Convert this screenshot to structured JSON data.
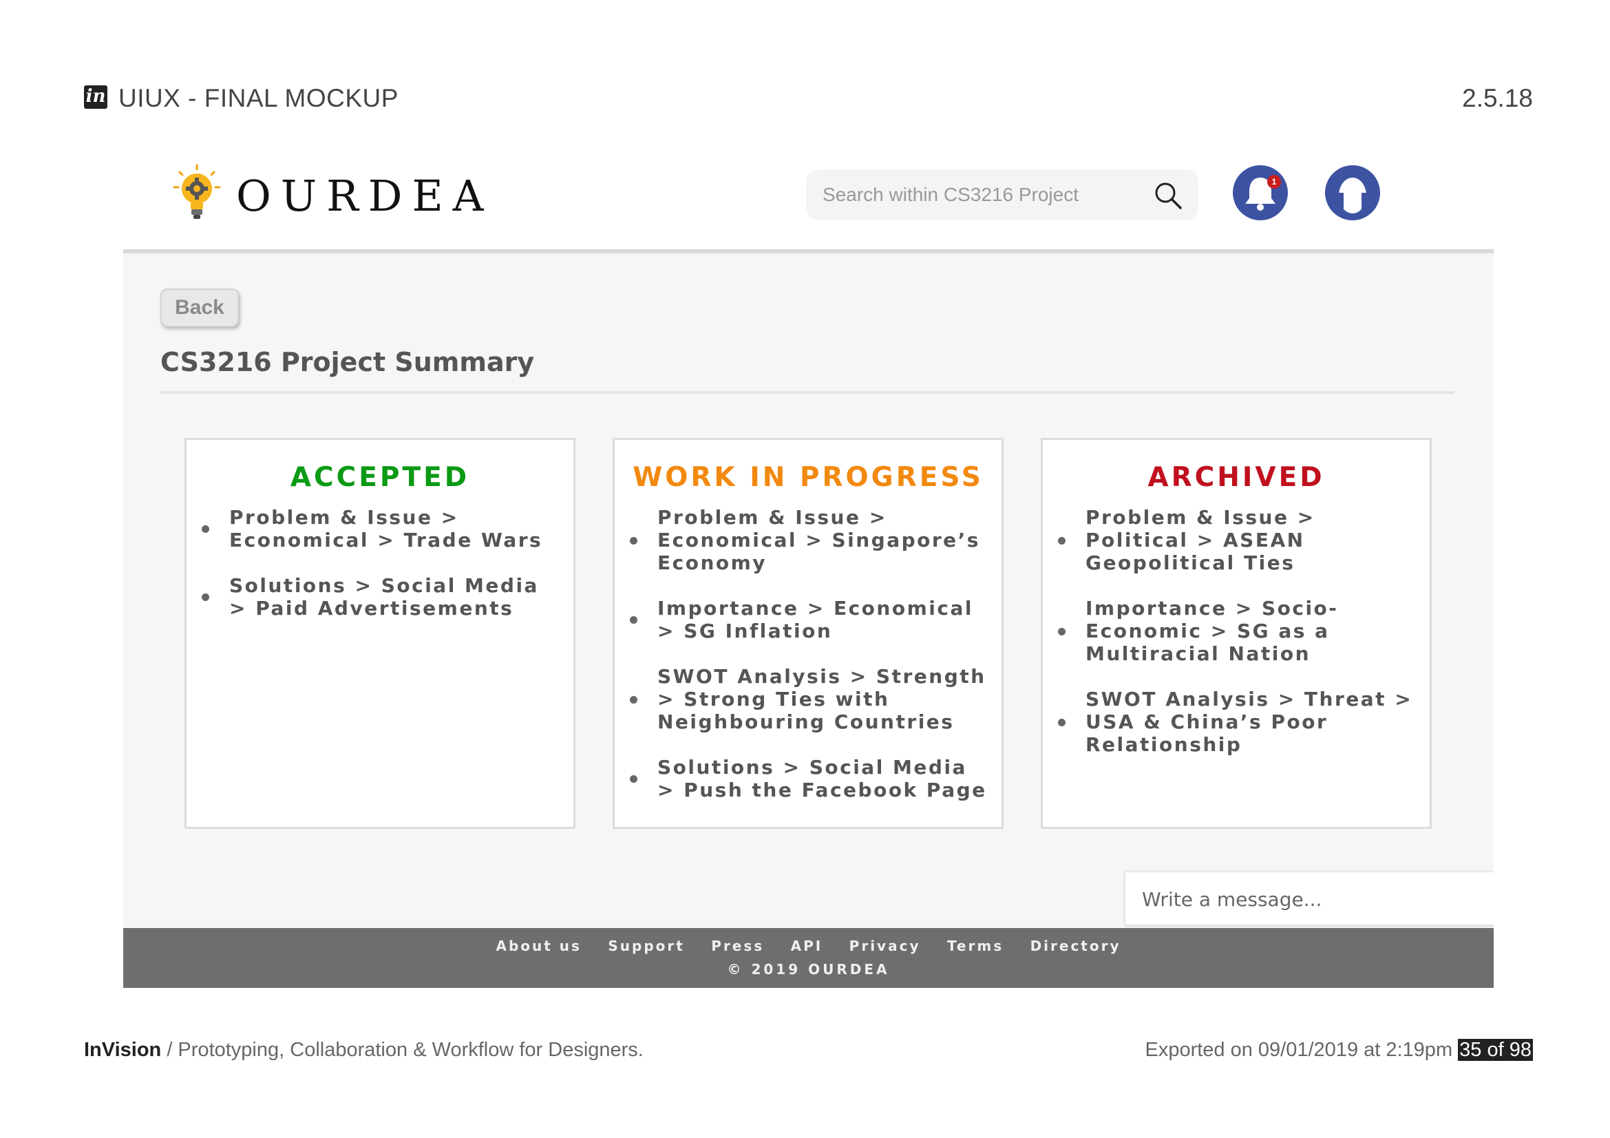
{
  "export_header": {
    "title": "UIUX - FINAL MOCKUP",
    "version": "2.5.18"
  },
  "app": {
    "brand": "OURDEA",
    "search": {
      "placeholder": "Search within CS3216 Project",
      "value": ""
    },
    "notifications_count": "1",
    "back_label": "Back",
    "page_title": "CS3216 Project Summary",
    "colors": {
      "accepted": "#0a9a14",
      "wip": "#f2890f",
      "archived": "#c0101e",
      "accent": "#3d52a0",
      "footer_bg": "#6e6e6e"
    },
    "columns": [
      {
        "heading": "ACCEPTED",
        "items": [
          "Problem & Issue > Economical > Trade Wars",
          "Solutions > Social Media > Paid Advertisements"
        ]
      },
      {
        "heading": "WORK IN PROGRESS",
        "items": [
          "Problem & Issue > Economical > Singapore’s Economy",
          "Importance > Economical > SG Inflation",
          "SWOT Analysis > Strength > Strong Ties with Neighbouring Countries",
          "Solutions > Social Media > Push the Facebook Page"
        ]
      },
      {
        "heading": "ARCHIVED",
        "items": [
          "Problem & Issue > Political > ASEAN Geopolitical Ties",
          "Importance > Socio-Economic > SG as a Multiracial Nation",
          "SWOT Analysis > Threat > USA & China’s Poor Relationship"
        ]
      }
    ],
    "message": {
      "placeholder": "Write a message...",
      "value": ""
    },
    "footer": {
      "links": [
        "About us",
        "Support",
        "Press",
        "API",
        "Privacy",
        "Terms",
        "Directory"
      ],
      "copyright": "© 2019 OURDEA"
    },
    "icons": [
      "lightbulb-gear-logo-icon",
      "search-icon",
      "bell-icon",
      "user-avatar-icon"
    ]
  },
  "export_footer": {
    "brand": "InVision",
    "tagline": " / Prototyping, Collaboration & Workflow for Designers.",
    "exported": "Exported on 09/01/2019 at 2:19pm",
    "page_counter": "35 of 98"
  }
}
